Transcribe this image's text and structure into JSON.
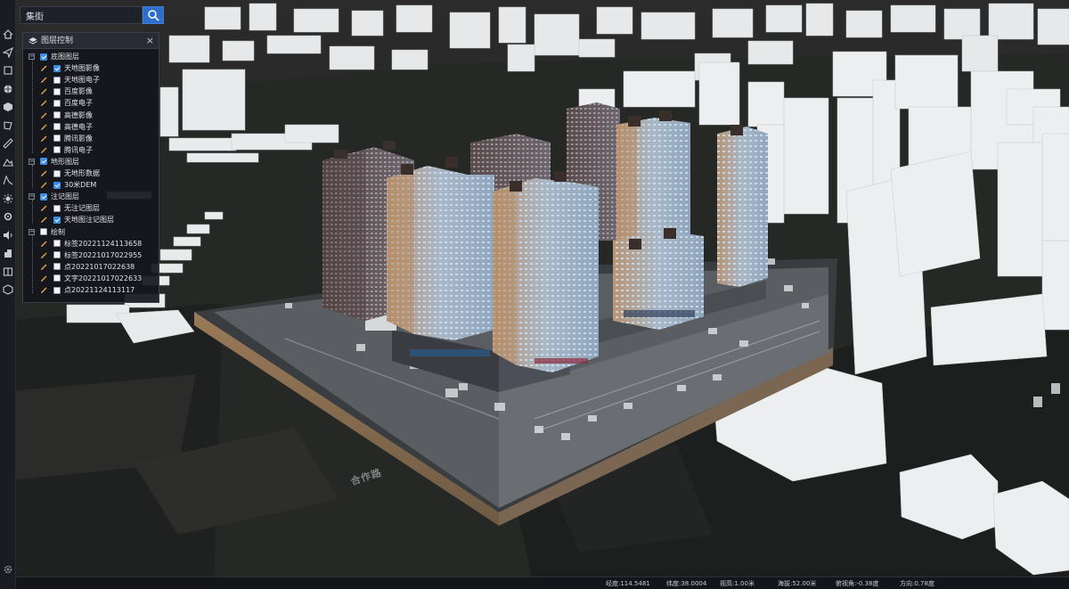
{
  "search": {
    "value": "集街",
    "placeholder": ""
  },
  "panel": {
    "title": "图层控制",
    "close_label": "×",
    "groups": [
      {
        "label": "底图图层",
        "checked": true,
        "items": [
          {
            "label": "天地图影像",
            "checked": true
          },
          {
            "label": "天地图电子",
            "checked": false
          },
          {
            "label": "百度影像",
            "checked": false
          },
          {
            "label": "百度电子",
            "checked": false
          },
          {
            "label": "高德影像",
            "checked": false
          },
          {
            "label": "高德电子",
            "checked": false
          },
          {
            "label": "腾讯影像",
            "checked": false
          },
          {
            "label": "腾讯电子",
            "checked": false
          }
        ]
      },
      {
        "label": "地形图层",
        "checked": true,
        "items": [
          {
            "label": "无地形数据",
            "checked": false
          },
          {
            "label": "30米DEM",
            "checked": true
          }
        ]
      },
      {
        "label": "注记图层",
        "checked": true,
        "items": [
          {
            "label": "无注记图层",
            "checked": false
          },
          {
            "label": "天地图注记图层",
            "checked": true
          }
        ]
      },
      {
        "label": "绘制",
        "checked": false,
        "items": [
          {
            "label": "标签20221124113658",
            "checked": false
          },
          {
            "label": "标签20221017022955",
            "checked": false
          },
          {
            "label": "点20221017022638",
            "checked": false
          },
          {
            "label": "文字20221017022633",
            "checked": false
          },
          {
            "label": "点20221124113117",
            "checked": false
          }
        ]
      }
    ]
  },
  "status": {
    "longitude": "经度:114.5481",
    "latitude": "纬度:38.0004",
    "view_height": "视高:1.00米",
    "altitude": "海拔:52.00米",
    "pitch": "俯视角:-0.38度",
    "heading": "方向:0.78度"
  },
  "map_label": "合作路",
  "toolbar_icons": [
    "home-icon",
    "measure-icon",
    "layer-icon",
    "globe-icon",
    "cube-icon",
    "polygon-icon",
    "ruler-icon",
    "terrain-icon",
    "profile-icon",
    "sun-icon",
    "settings-icon",
    "sound-icon",
    "building-icon",
    "compare-icon",
    "model-icon",
    "gear-icon"
  ],
  "colors": {
    "accent": "#3b8ee8",
    "panel_bg": "#16181e",
    "search_button": "#2f6fc9"
  }
}
